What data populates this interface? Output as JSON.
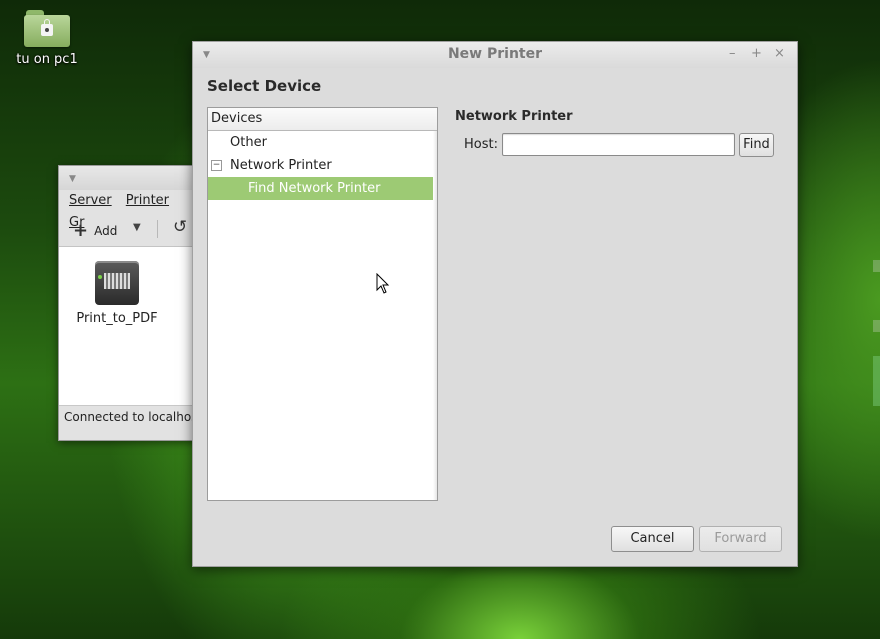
{
  "desktop": {
    "icon_label": "tu on pc1"
  },
  "printer_settings_window": {
    "menu": [
      "Server",
      "Printer",
      "Gr"
    ],
    "toolbar": {
      "add_label": "Add"
    },
    "printers": [
      {
        "name": "Print_to_PDF"
      }
    ],
    "status": "Connected to localhost"
  },
  "dialog": {
    "title": "New Printer",
    "heading": "Select Device",
    "tree": {
      "header": "Devices",
      "items": [
        {
          "label": "Other"
        },
        {
          "label": "Network Printer",
          "expander": "−"
        },
        {
          "label": "Find Network Printer",
          "selected": true
        }
      ]
    },
    "section_title": "Network Printer",
    "host": {
      "label": "Host:",
      "value": "",
      "placeholder": ""
    },
    "buttons": {
      "find": "Find",
      "cancel": "Cancel",
      "forward": "Forward"
    }
  },
  "colors": {
    "selection": "#9dca74",
    "desktop_green": "#2d7014"
  }
}
